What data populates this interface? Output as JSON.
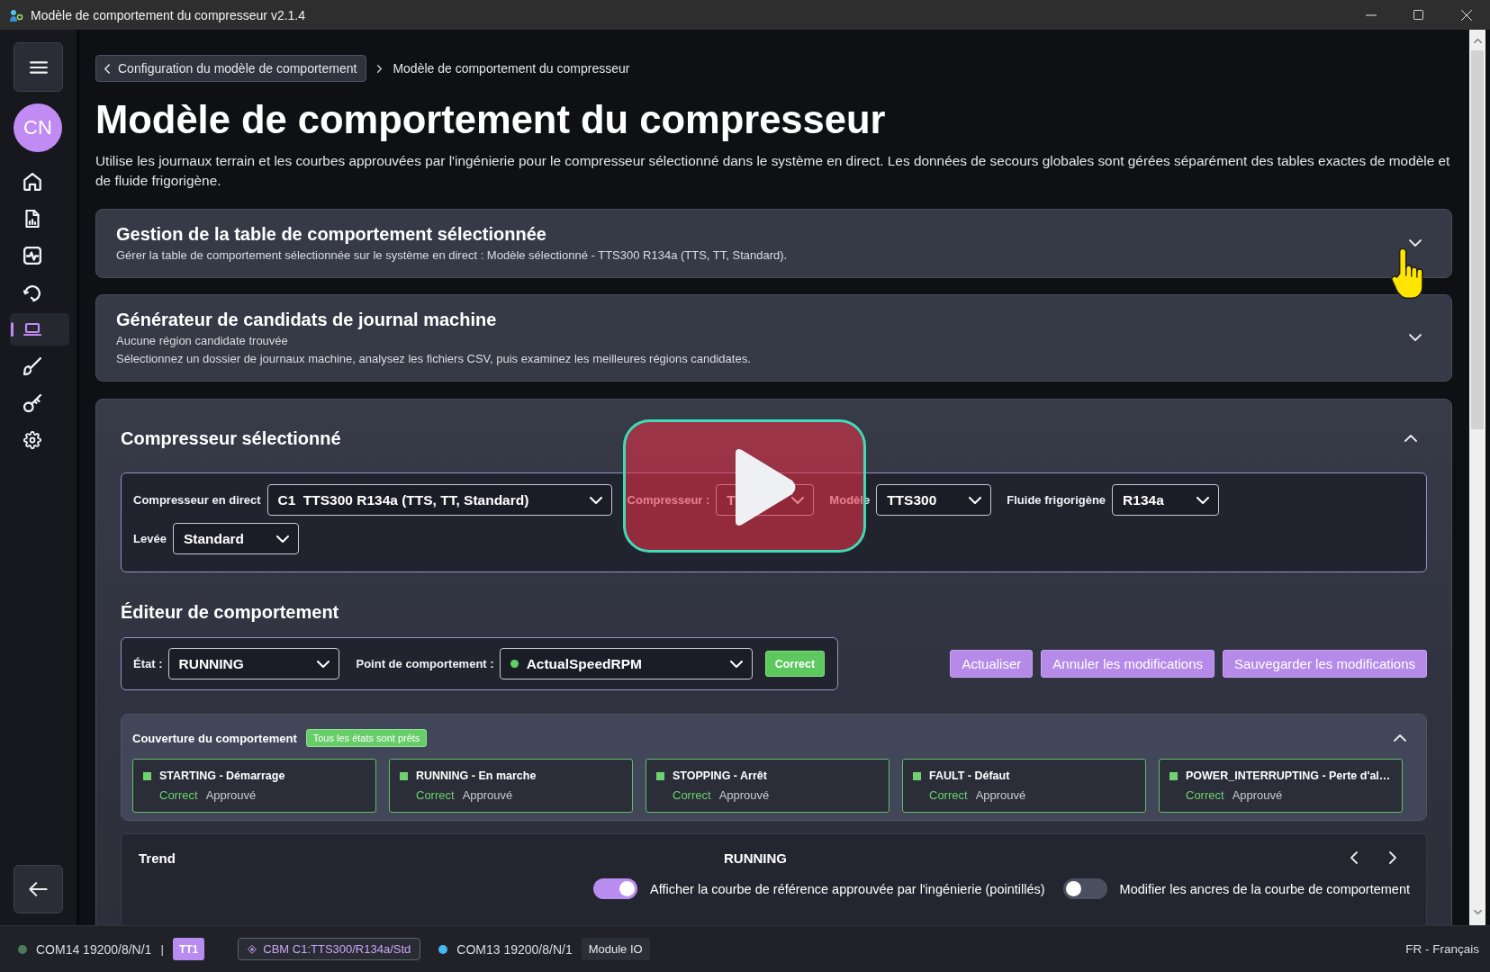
{
  "window": {
    "title": "Modèle de comportement du compresseur v2.1.4"
  },
  "sidebar": {
    "avatar": "CN",
    "items": [
      {
        "kind": "home",
        "selected": false
      },
      {
        "kind": "report",
        "selected": false
      },
      {
        "kind": "activity",
        "selected": false
      },
      {
        "kind": "history",
        "selected": false
      },
      {
        "kind": "laptop",
        "selected": true
      },
      {
        "kind": "brush",
        "selected": false
      },
      {
        "kind": "key",
        "selected": false
      },
      {
        "kind": "settings",
        "selected": false
      }
    ]
  },
  "breadcrumb": {
    "back": "Configuration du modèle de comportement",
    "current": "Modèle de comportement du compresseur"
  },
  "page": {
    "title": "Modèle de comportement du compresseur",
    "description": "Utilise les journaux terrain et les courbes approuvées par l'ingénierie pour le compresseur sélectionné dans le système en direct. Les données de secours globales sont gérées séparément des tables exactes de modèle et de fluide frigorigène."
  },
  "sections": [
    {
      "title": "Gestion de la table de comportement sélectionnée",
      "lines": [
        "Gérer la table de comportement sélectionnée sur le système en direct : Modèle sélectionné - TTS300 R134a (TTS, TT, Standard)."
      ],
      "expanded": false
    },
    {
      "title": "Générateur de candidats de journal machine",
      "lines": [
        "Aucune région candidate trouvée",
        "Sélectionnez un dossier de journaux machine, analysez les fichiers CSV, puis examinez les meilleures régions candidates."
      ],
      "expanded": false
    }
  ],
  "compressor": {
    "title": "Compresseur sélectionné",
    "expanded": true,
    "rows": [
      [
        {
          "label": "Compresseur en direct",
          "prefix": "C1",
          "value": "TTS300 R134a (TTS, TT, Standard)"
        },
        {
          "label": "Compresseur :",
          "value": "T"
        },
        {
          "label": "Modèle",
          "value": "TTS300"
        },
        {
          "label": "Fluide frigorigène",
          "value": "R134a"
        }
      ],
      [
        {
          "label": "Levée",
          "value": "Standard"
        }
      ]
    ]
  },
  "editor": {
    "title": "Éditeur de comportement",
    "state": {
      "label": "État :",
      "value": "RUNNING"
    },
    "point": {
      "label": "Point de comportement :",
      "value": "ActualSpeedRPM"
    },
    "badge": "Correct",
    "buttons": [
      "Actualiser",
      "Annuler les modifications",
      "Sauvegarder les modifications"
    ]
  },
  "coverage": {
    "title": "Couverture du comportement",
    "badge": "Tous les états sont prêts",
    "expanded": true,
    "states": [
      {
        "name": "STARTING - Démarrage",
        "status": "Correct",
        "approval": "Approuvé"
      },
      {
        "name": "RUNNING - En marche",
        "status": "Correct",
        "approval": "Approuvé"
      },
      {
        "name": "STOPPING - Arrêt",
        "status": "Correct",
        "approval": "Approuvé"
      },
      {
        "name": "FAULT - Défaut",
        "status": "Correct",
        "approval": "Approuvé"
      },
      {
        "name": "POWER_INTERRUPTING - Perte d'al…",
        "status": "Correct",
        "approval": "Approuvé"
      }
    ]
  },
  "trend": {
    "title": "Trend",
    "state": "RUNNING",
    "toggles": [
      {
        "label": "Afficher la courbe de référence approuvée par l'ingénierie (pointillés)",
        "on": true
      },
      {
        "label": "Modifier les ancres de la courbe de comportement",
        "on": false
      }
    ]
  },
  "status_bar": {
    "items": [
      {
        "kind": "port",
        "text": "COM14 19200/8/N/1",
        "color": "#4a7c5c"
      },
      {
        "kind": "divider",
        "text": "|"
      },
      {
        "kind": "badge",
        "text": "TT1"
      },
      {
        "kind": "tag",
        "text": "CBM C1:TTS300/R134a/Std"
      },
      {
        "kind": "port",
        "text": "COM13 19200/8/N/1",
        "color": "#45b8f5"
      },
      {
        "kind": "chip",
        "text": "Module IO"
      }
    ],
    "language": "FR - Français"
  }
}
